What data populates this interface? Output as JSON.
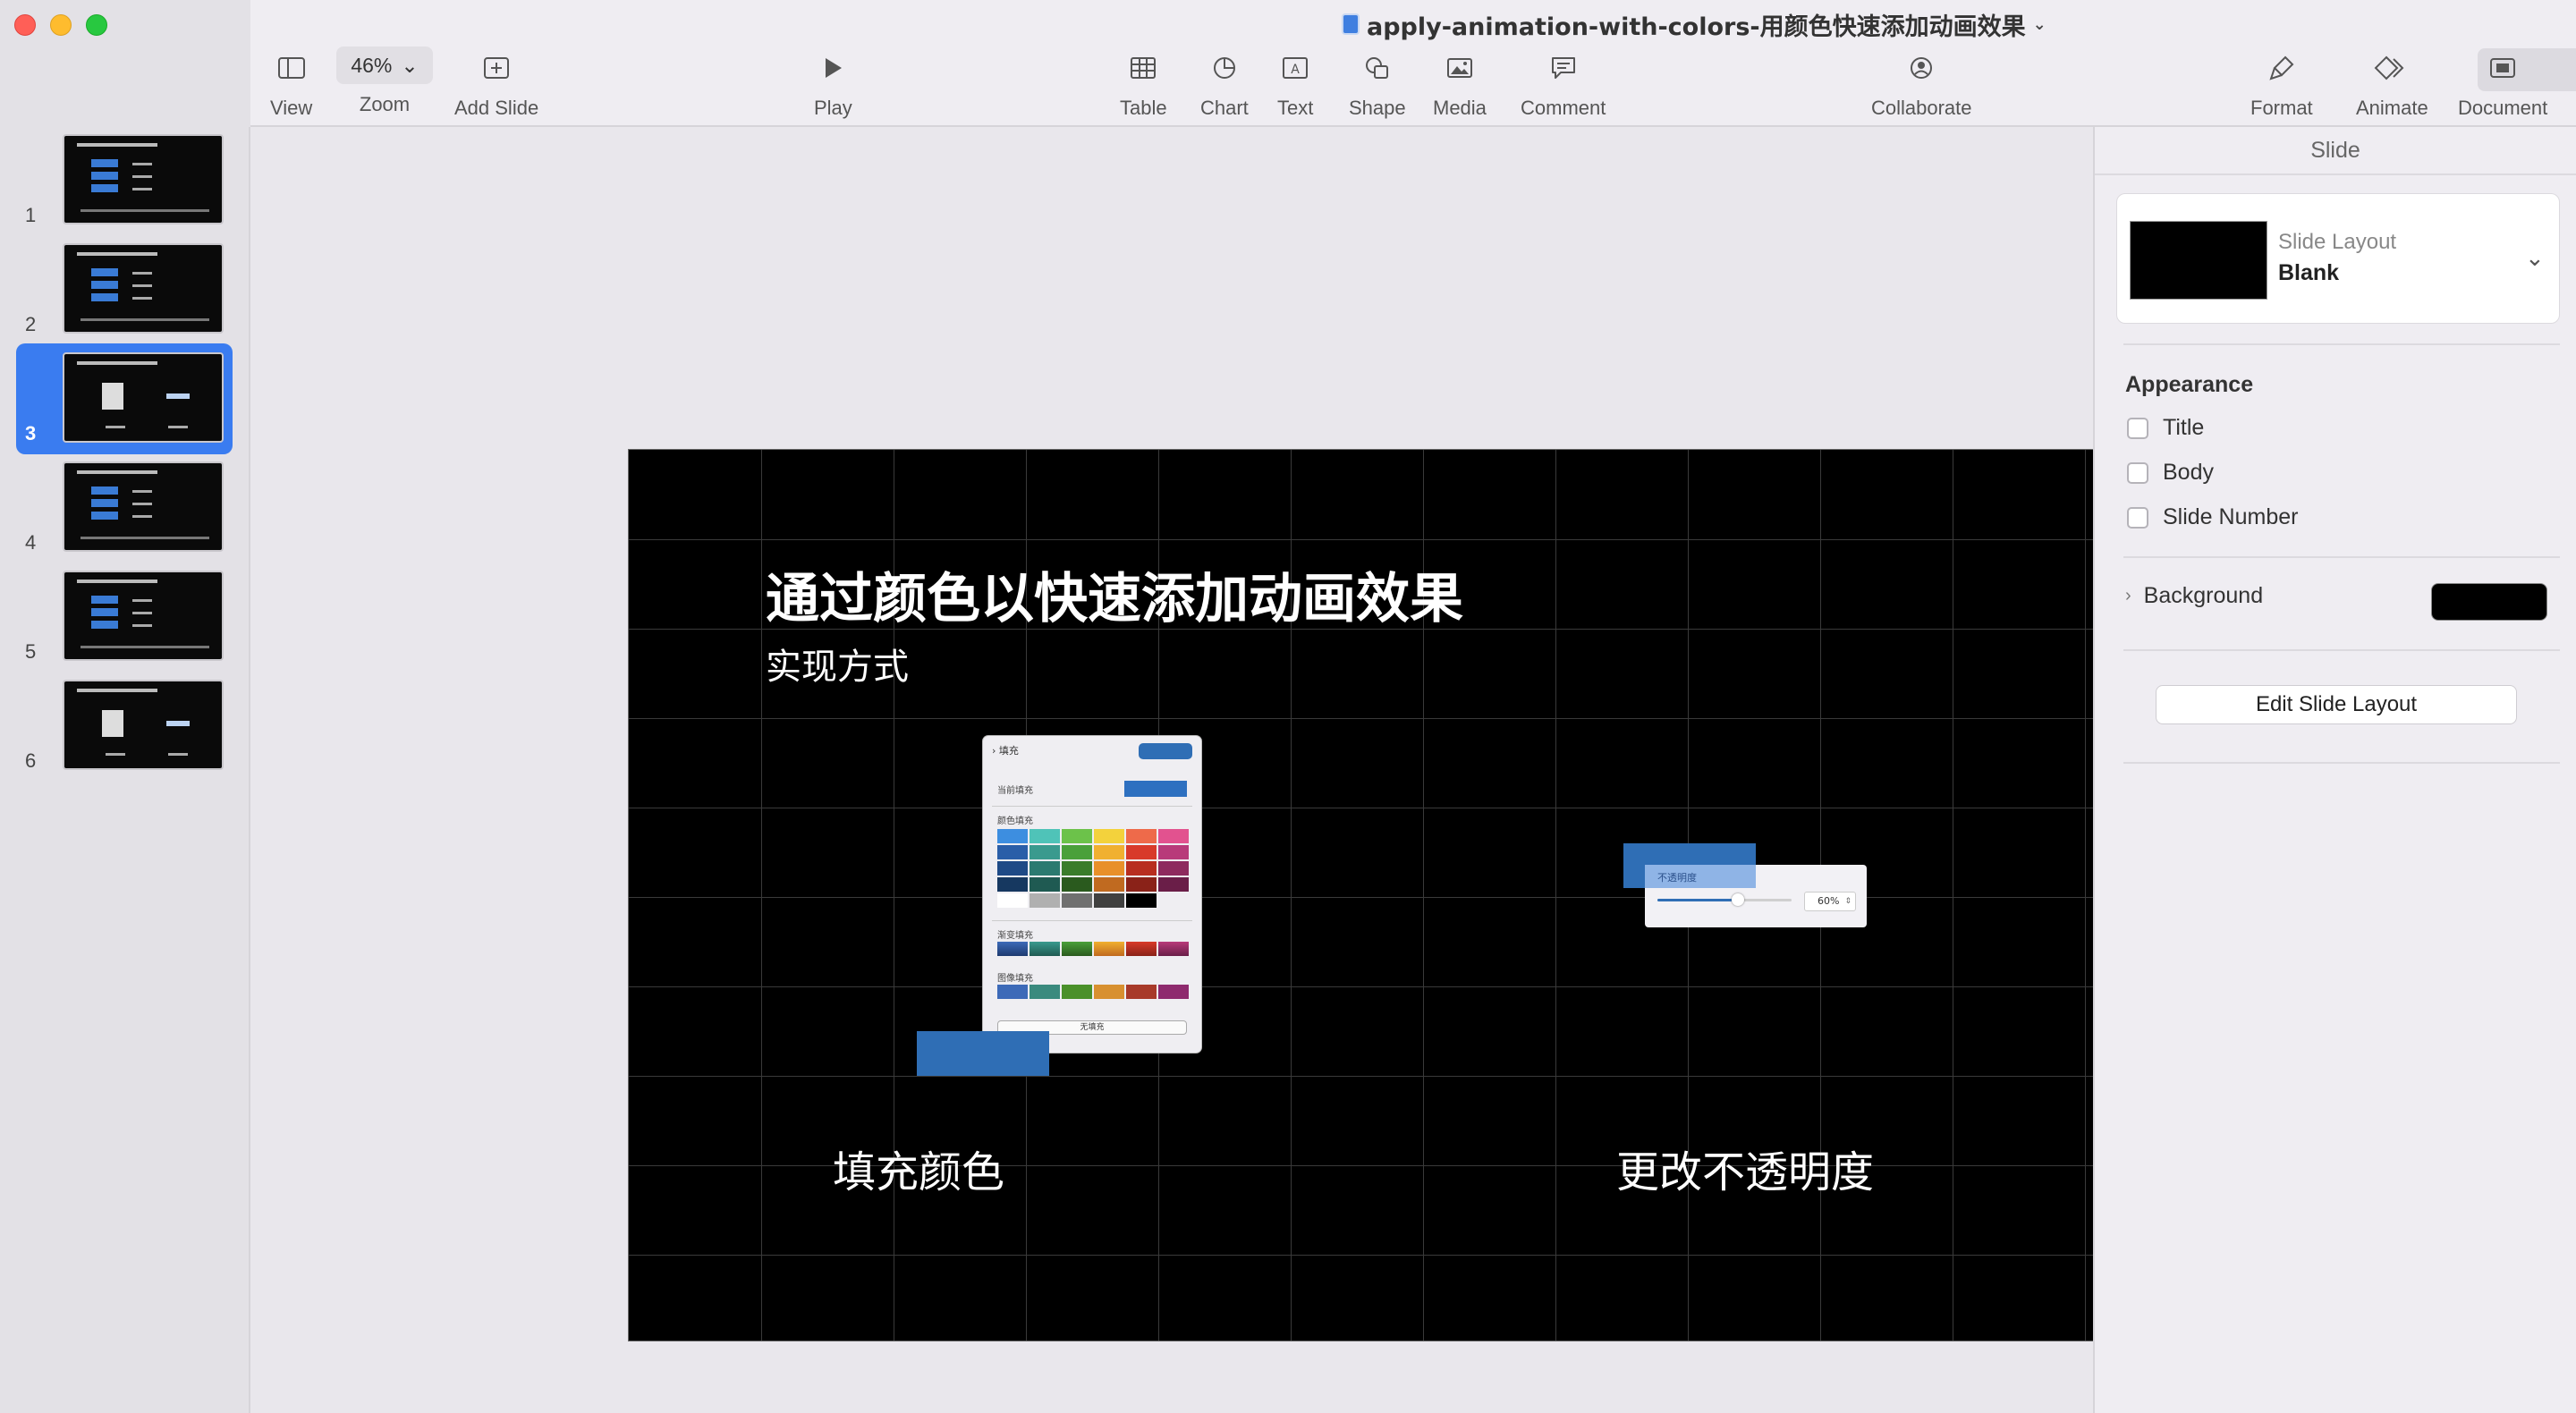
{
  "window": {
    "title": "apply-animation-with-colors-用颜色快速添加动画效果"
  },
  "toolbar": {
    "view_label": "View",
    "zoom_value": "46%",
    "zoom_label": "Zoom",
    "add_slide_label": "Add Slide",
    "play_label": "Play",
    "table_label": "Table",
    "chart_label": "Chart",
    "text_label": "Text",
    "shape_label": "Shape",
    "media_label": "Media",
    "comment_label": "Comment",
    "collaborate_label": "Collaborate",
    "format_label": "Format",
    "animate_label": "Animate",
    "document_label": "Document"
  },
  "navigator": {
    "slides": [
      {
        "number": "1"
      },
      {
        "number": "2"
      },
      {
        "number": "3",
        "selected": true
      },
      {
        "number": "4"
      },
      {
        "number": "5"
      },
      {
        "number": "6"
      }
    ]
  },
  "slide": {
    "title": "通过颜色以快速添加动画效果",
    "subtitle": "实现方式",
    "caption_left": "填充颜色",
    "caption_right": "更改不透明度",
    "fill_panel": {
      "header": "填充",
      "current_fill": "当前填充",
      "color_fill": "颜色填充",
      "gradient_fill": "渐变填充",
      "image_fill": "图像填充",
      "no_fill": "无填充"
    },
    "opacity": {
      "label": "不透明度",
      "value": "60%",
      "fraction": 0.6
    }
  },
  "inspector": {
    "header": "Slide",
    "layout_label": "Slide Layout",
    "layout_value": "Blank",
    "appearance_title": "Appearance",
    "checks": [
      {
        "label": "Title",
        "checked": false
      },
      {
        "label": "Body",
        "checked": false
      },
      {
        "label": "Slide Number",
        "checked": false
      }
    ],
    "background_label": "Background",
    "background_color": "#000000",
    "edit_layout_button": "Edit Slide Layout"
  },
  "colors": {
    "accent": "#3a7cf0",
    "fill_blue": "#2f6eb5"
  }
}
